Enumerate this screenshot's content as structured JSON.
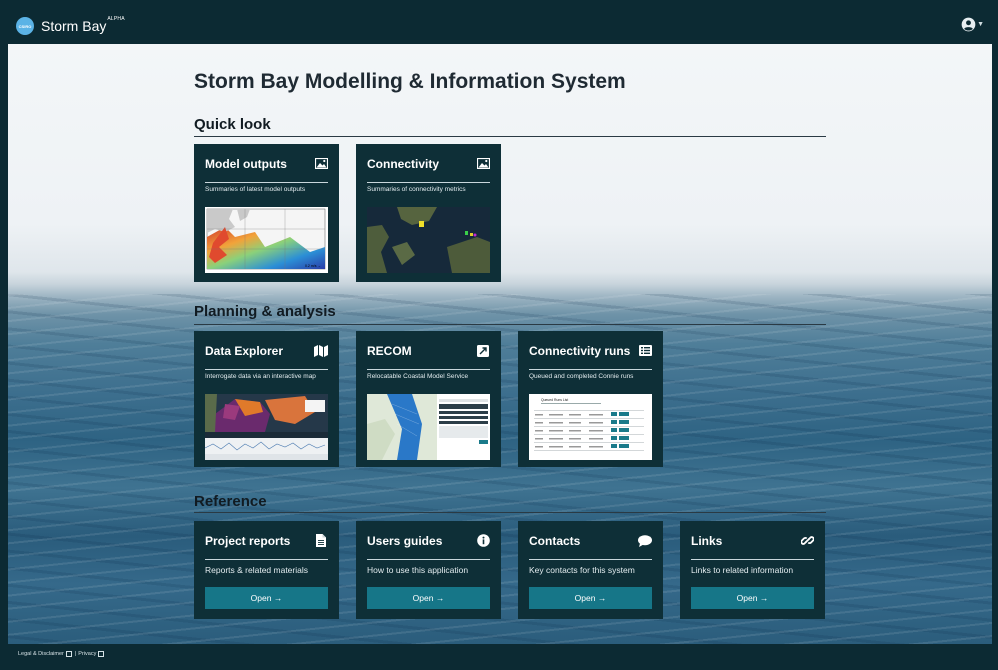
{
  "navbar": {
    "brand": "Storm Bay",
    "tag": "ALPHA",
    "logo_text": "CSIRO"
  },
  "page": {
    "title": "Storm Bay Modelling & Information System"
  },
  "sections": {
    "quick_look": "Quick look",
    "planning": "Planning & analysis",
    "reference": "Reference"
  },
  "cards": {
    "model_outputs": {
      "title": "Model outputs",
      "desc": "Summaries of latest model outputs",
      "icon": "image-icon"
    },
    "connectivity": {
      "title": "Connectivity",
      "desc": "Summaries of connectivity metrics",
      "icon": "image-icon"
    },
    "data_explorer": {
      "title": "Data Explorer",
      "desc": "Interrogate data via an interactive map",
      "icon": "map-icon"
    },
    "recom": {
      "title": "RECOM",
      "desc": "Relocatable Coastal Model Service",
      "icon": "external-link-icon"
    },
    "connectivity_runs": {
      "title": "Connectivity runs",
      "desc": "Queued and completed Connie runs",
      "icon": "list-icon"
    },
    "project_reports": {
      "title": "Project reports",
      "desc": "Reports & related materials",
      "button": "Open →",
      "icon": "file-icon"
    },
    "users_guides": {
      "title": "Users guides",
      "desc": "How to use this application",
      "button": "Open →",
      "icon": "info-icon"
    },
    "contacts": {
      "title": "Contacts",
      "desc": "Key contacts for this system",
      "button": "Open →",
      "icon": "comment-icon"
    },
    "links": {
      "title": "Links",
      "desc": "Links to related information",
      "button": "Open →",
      "icon": "link-icon"
    }
  },
  "thumbnails": {
    "connectivity_runs_heading": "Queued Runs List"
  },
  "footer": {
    "legal": "Legal & Disclaimer",
    "separator": "|",
    "privacy": "Privacy"
  },
  "colors": {
    "navbar": "#0c2a33",
    "card": "#0e2f37",
    "button": "#167688"
  }
}
